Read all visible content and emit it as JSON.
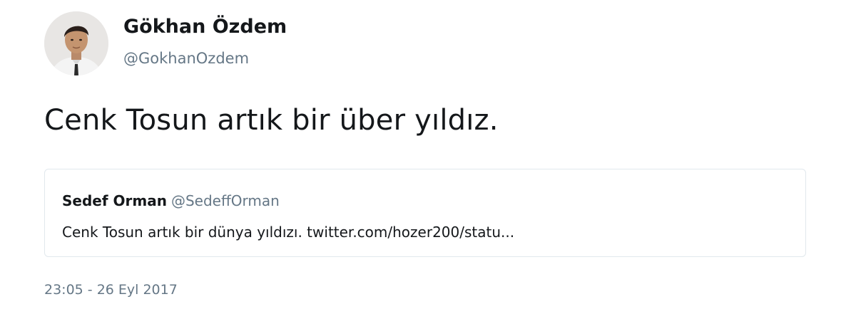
{
  "tweet": {
    "author": {
      "name": "Gökhan Özdem",
      "handle": "@GokhanOzdem",
      "avatar_icon": "profile-photo"
    },
    "text": "Cenk Tosun artık bir über yıldız.",
    "quoted_tweet": {
      "name": "Sedef Orman",
      "handle": "@SedeffOrman",
      "text": "Cenk Tosun artık bir dünya yıldızı. twitter.com/hozer200/statu..."
    },
    "timestamp": "23:05 - 26 Eyl 2017"
  },
  "colors": {
    "text_primary": "#14171a",
    "text_secondary": "#657786",
    "quote_border": "#e1e8ed",
    "background": "#ffffff"
  }
}
